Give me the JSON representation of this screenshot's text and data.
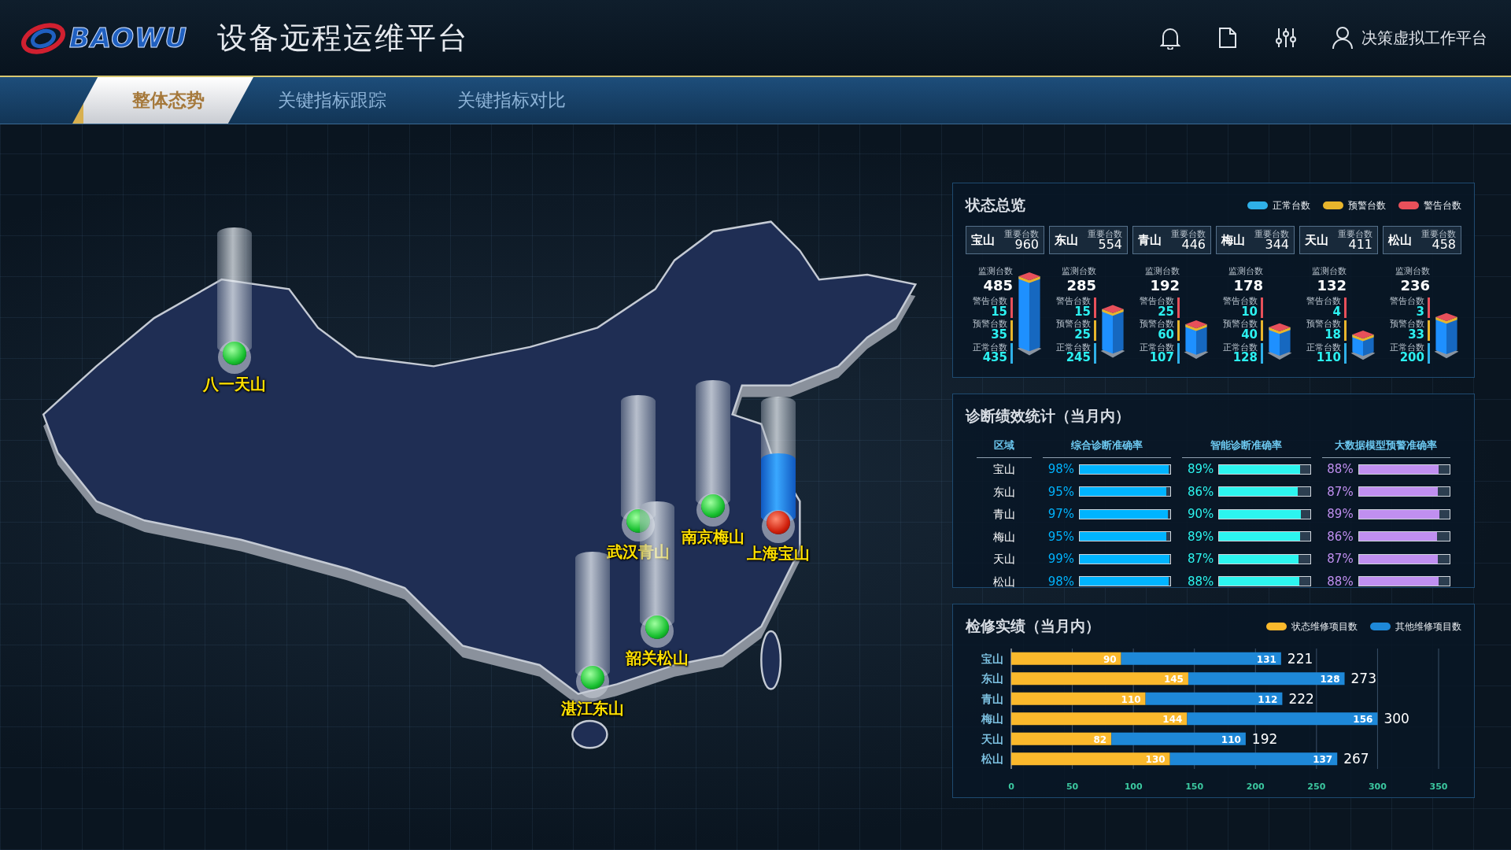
{
  "header": {
    "logo_text": "BAOWU",
    "title": "设备远程运维平台",
    "user": "决策虚拟工作平台"
  },
  "tabs": [
    {
      "label": "整体态势",
      "selected": true
    },
    {
      "label": "关键指标跟踪",
      "selected": false
    },
    {
      "label": "关键指标对比",
      "selected": false
    }
  ],
  "map": {
    "pins": [
      {
        "name": "八一天山",
        "alert": false
      },
      {
        "name": "武汉青山",
        "alert": false
      },
      {
        "name": "南京梅山",
        "alert": false
      },
      {
        "name": "上海宝山",
        "alert": true
      },
      {
        "name": "韶关松山",
        "alert": false
      },
      {
        "name": "湛江东山",
        "alert": false
      }
    ]
  },
  "status_overview": {
    "title": "状态总览",
    "legend": [
      {
        "label": "正常台数",
        "color": "#2fb0e8"
      },
      {
        "label": "预警台数",
        "color": "#e8b52c"
      },
      {
        "label": "警告台数",
        "color": "#e8505a"
      }
    ],
    "sites": [
      {
        "name": "宝山",
        "key_label": "重要台数",
        "key_value": "960",
        "monitor_label": "监测台数",
        "monitor_value": "485",
        "stats": [
          {
            "label": "警告台数",
            "value": "15",
            "color": "#e8505a"
          },
          {
            "label": "预警台数",
            "value": "35",
            "color": "#e8b52c"
          },
          {
            "label": "正常台数",
            "value": "435",
            "color": "#2fb0e8"
          }
        ]
      },
      {
        "name": "东山",
        "key_label": "重要台数",
        "key_value": "554",
        "monitor_label": "监测台数",
        "monitor_value": "285",
        "stats": [
          {
            "label": "警告台数",
            "value": "15",
            "color": "#e8505a"
          },
          {
            "label": "预警台数",
            "value": "25",
            "color": "#e8b52c"
          },
          {
            "label": "正常台数",
            "value": "245",
            "color": "#2fb0e8"
          }
        ]
      },
      {
        "name": "青山",
        "key_label": "重要台数",
        "key_value": "446",
        "monitor_label": "监测台数",
        "monitor_value": "192",
        "stats": [
          {
            "label": "警告台数",
            "value": "25",
            "color": "#e8505a"
          },
          {
            "label": "预警台数",
            "value": "60",
            "color": "#e8b52c"
          },
          {
            "label": "正常台数",
            "value": "107",
            "color": "#2fb0e8"
          }
        ]
      },
      {
        "name": "梅山",
        "key_label": "重要台数",
        "key_value": "344",
        "monitor_label": "监测台数",
        "monitor_value": "178",
        "stats": [
          {
            "label": "警告台数",
            "value": "10",
            "color": "#e8505a"
          },
          {
            "label": "预警台数",
            "value": "40",
            "color": "#e8b52c"
          },
          {
            "label": "正常台数",
            "value": "128",
            "color": "#2fb0e8"
          }
        ]
      },
      {
        "name": "天山",
        "key_label": "重要台数",
        "key_value": "411",
        "monitor_label": "监测台数",
        "monitor_value": "132",
        "stats": [
          {
            "label": "警告台数",
            "value": "4",
            "color": "#e8505a"
          },
          {
            "label": "预警台数",
            "value": "18",
            "color": "#e8b52c"
          },
          {
            "label": "正常台数",
            "value": "110",
            "color": "#2fb0e8"
          }
        ]
      },
      {
        "name": "松山",
        "key_label": "重要台数",
        "key_value": "458",
        "monitor_label": "监测台数",
        "monitor_value": "236",
        "stats": [
          {
            "label": "警告台数",
            "value": "3",
            "color": "#e8505a"
          },
          {
            "label": "预警台数",
            "value": "33",
            "color": "#e8b52c"
          },
          {
            "label": "正常台数",
            "value": "200",
            "color": "#2fb0e8"
          }
        ]
      }
    ]
  },
  "diagnosis": {
    "title": "诊断绩效统计（当月内）",
    "columns": [
      {
        "label": "区域"
      },
      {
        "label": "综合诊断准确率",
        "color": "#00b4ff"
      },
      {
        "label": "智能诊断准确率",
        "color": "#2cf5ef"
      },
      {
        "label": "大数据模型预警准确率",
        "color": "#c08ff0"
      }
    ],
    "rows": [
      {
        "region": "宝山",
        "cells": [
          {
            "text": "98%",
            "level": 0.98
          },
          {
            "text": "89%",
            "level": 0.89
          },
          {
            "text": "88%",
            "level": 0.88
          }
        ]
      },
      {
        "region": "东山",
        "cells": [
          {
            "text": "95%",
            "level": 0.95
          },
          {
            "text": "86%",
            "level": 0.86
          },
          {
            "text": "87%",
            "level": 0.87
          }
        ]
      },
      {
        "region": "青山",
        "cells": [
          {
            "text": "97%",
            "level": 0.97
          },
          {
            "text": "90%",
            "level": 0.9
          },
          {
            "text": "89%",
            "level": 0.89
          }
        ]
      },
      {
        "region": "梅山",
        "cells": [
          {
            "text": "95%",
            "level": 0.95
          },
          {
            "text": "89%",
            "level": 0.89
          },
          {
            "text": "86%",
            "level": 0.86
          }
        ]
      },
      {
        "region": "天山",
        "cells": [
          {
            "text": "99%",
            "level": 0.99
          },
          {
            "text": "87%",
            "level": 0.87
          },
          {
            "text": "87%",
            "level": 0.87
          }
        ]
      },
      {
        "region": "松山",
        "cells": [
          {
            "text": "98%",
            "level": 0.98
          },
          {
            "text": "88%",
            "level": 0.88
          },
          {
            "text": "88%",
            "level": 0.88
          }
        ]
      }
    ]
  },
  "maintenance": {
    "title": "检修实绩（当月内）",
    "chart_data": {
      "type": "bar",
      "orientation": "horizontal",
      "stacked": true,
      "data_labels": true,
      "categories": [
        "宝山",
        "东山",
        "青山",
        "梅山",
        "天山",
        "松山"
      ],
      "series": [
        {
          "name": "状态维修项目数",
          "color": "#fbb92c",
          "values": [
            90,
            145,
            110,
            144,
            82,
            130
          ]
        },
        {
          "name": "其他维修项目数",
          "color": "#1e88d8",
          "values": [
            131,
            128,
            112,
            156,
            110,
            137
          ]
        }
      ],
      "grid": true,
      "xlim": [
        0,
        350
      ],
      "xticks": [
        0,
        50,
        100,
        150,
        200,
        250,
        300,
        350
      ],
      "annotations": [
        "221",
        "273",
        "222",
        "300",
        "192",
        "267"
      ]
    }
  }
}
